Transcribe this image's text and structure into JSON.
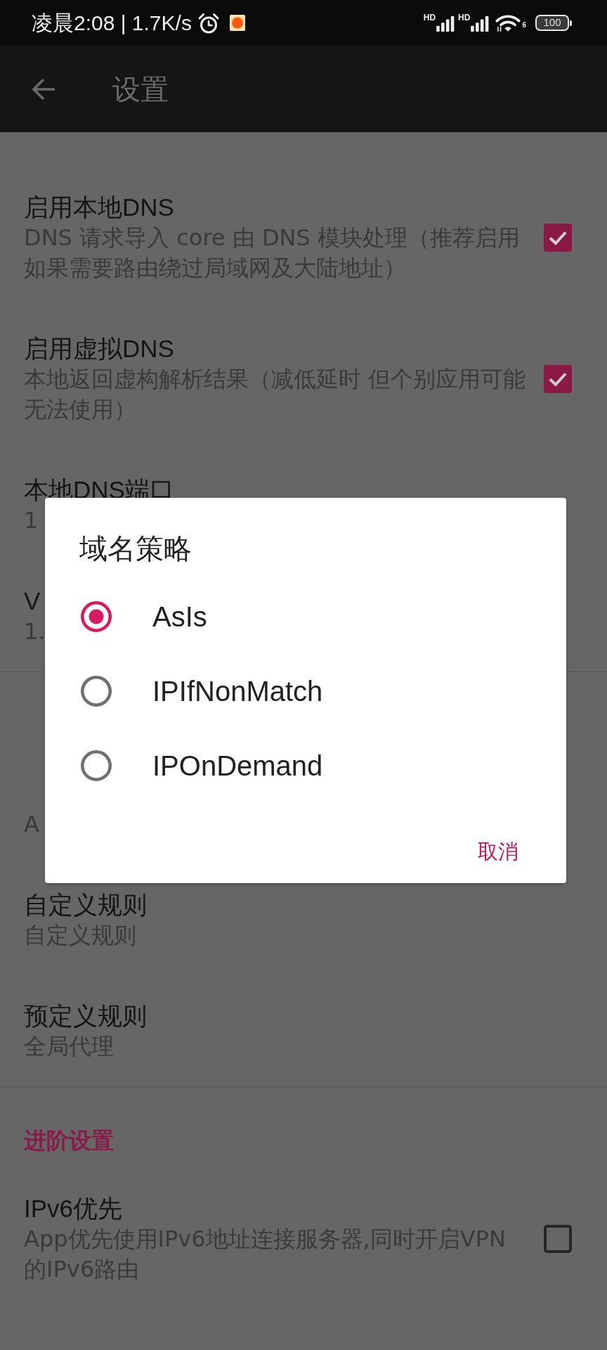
{
  "status_bar": {
    "text": "凌晨2:08 | 1.7K/s",
    "signal_labels": [
      "HD",
      "HD"
    ],
    "wifi_label": "6",
    "battery": "100"
  },
  "app_bar": {
    "title": "设置"
  },
  "groups": [
    {
      "items": [
        {
          "kind": "checkbox",
          "title": "启用本地DNS",
          "summary": "DNS 请求导入 core 由 DNS 模块处理（推荐启用如果需要路由绕过局域网及大陆地址）",
          "checked": true
        },
        {
          "kind": "checkbox",
          "title": "启用虚拟DNS",
          "summary": "本地返回虚构解析结果（减低延时 但个别应用可能无法使用）",
          "checked": true
        },
        {
          "kind": "text",
          "title": "本地DNS端口",
          "summary": "1"
        },
        {
          "kind": "text",
          "title": "V",
          "summary": "1."
        }
      ]
    },
    {
      "items": [
        {
          "kind": "text",
          "summary": "A"
        },
        {
          "kind": "text",
          "title": "自定义规则",
          "summary": "自定义规则"
        },
        {
          "kind": "text",
          "title": "预定义规则",
          "summary": "全局代理"
        }
      ]
    },
    {
      "header": "进阶设置",
      "items": [
        {
          "kind": "checkbox",
          "title": "IPv6优先",
          "summary": "App优先使用IPv6地址连接服务器,同时开启VPN的IPv6路由",
          "checked": false
        }
      ]
    }
  ],
  "dialog": {
    "title": "域名策略",
    "options": [
      {
        "label": "AsIs",
        "selected": true
      },
      {
        "label": "IPIfNonMatch",
        "selected": false
      },
      {
        "label": "IPOnDemand",
        "selected": false
      }
    ],
    "buttons": [
      "取消"
    ]
  }
}
